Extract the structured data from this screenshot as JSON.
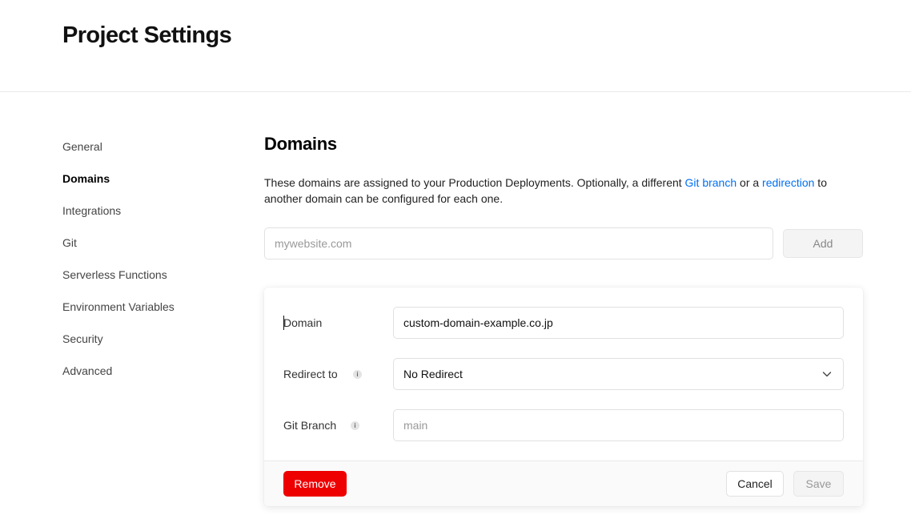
{
  "header": {
    "title": "Project Settings"
  },
  "sidebar": {
    "items": [
      {
        "label": "General"
      },
      {
        "label": "Domains",
        "active": true
      },
      {
        "label": "Integrations"
      },
      {
        "label": "Git"
      },
      {
        "label": "Serverless Functions"
      },
      {
        "label": "Environment Variables"
      },
      {
        "label": "Security"
      },
      {
        "label": "Advanced"
      }
    ]
  },
  "domains": {
    "title": "Domains",
    "description": {
      "before": "These domains are assigned to your Production Deployments. Optionally, a different ",
      "link1": "Git branch",
      "middle": " or a ",
      "link2": "redirection",
      "after": " to another domain can be configured for each one."
    },
    "add_input": {
      "placeholder": "mywebsite.com",
      "value": ""
    },
    "add_button": "Add"
  },
  "domain_card": {
    "domain": {
      "label": "Domain",
      "value": "custom-domain-example.co.jp"
    },
    "redirect": {
      "label": "Redirect to",
      "selected": "No Redirect",
      "icon": "info-icon"
    },
    "git_branch": {
      "label": "Git Branch",
      "placeholder": "main",
      "value": "",
      "icon": "info-icon"
    },
    "remove_button": "Remove",
    "cancel_button": "Cancel",
    "save_button": "Save"
  },
  "colors": {
    "link": "#0070f3",
    "danger": "#ee0000",
    "border": "#eaeaea"
  }
}
